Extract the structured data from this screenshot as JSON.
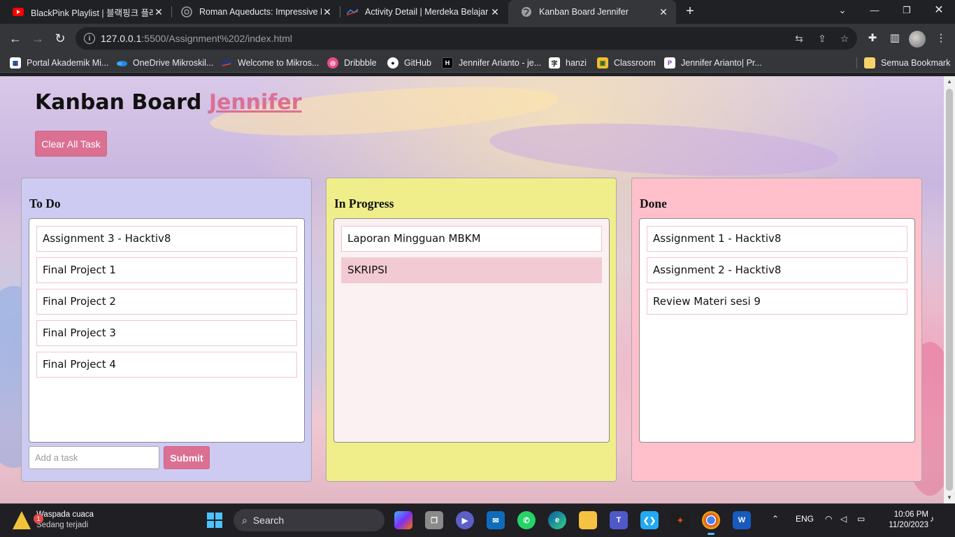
{
  "browser": {
    "tabs": [
      {
        "title": "BlackPink Playlist | 블랙핑크 플레이리스트",
        "icon": "youtube-icon"
      },
      {
        "title": "Roman Aqueducts: Impressive Engineering",
        "icon": "chatgpt-icon"
      },
      {
        "title": "Activity Detail | Merdeka Belajar",
        "icon": "merdeka-icon"
      },
      {
        "title": "Kanban Board Jennifer",
        "icon": "globe-icon"
      }
    ],
    "url_host": "127.0.0.1",
    "url_path": ":5500/Assignment%202/index.html",
    "bookmarks": [
      {
        "label": "Portal Akademik Mi...",
        "icon": "portal-icon"
      },
      {
        "label": "OneDrive Mikroskil...",
        "icon": "onedrive-icon"
      },
      {
        "label": "Welcome to Mikros...",
        "icon": "mikroskil-icon"
      },
      {
        "label": "Dribbble",
        "icon": "dribbble-icon"
      },
      {
        "label": "GitHub",
        "icon": "github-icon"
      },
      {
        "label": "Jennifer Arianto - je...",
        "icon": "hashnode-icon"
      },
      {
        "label": "hanzi",
        "icon": "hanzi-icon"
      },
      {
        "label": "Classroom",
        "icon": "classroom-icon"
      },
      {
        "label": "Jennifer Arianto| Pr...",
        "icon": "portfolio-icon"
      }
    ],
    "all_bookmarks": "Semua Bookmark"
  },
  "page": {
    "title_prefix": "Kanban Board ",
    "title_name": "Jennifer",
    "clear_button": "Clear All Task",
    "columns": {
      "todo": {
        "title": "To Do",
        "tasks": [
          "Assignment 3 - Hacktiv8",
          "Final Project 1",
          "Final Project 2",
          "Final Project 3",
          "Final Project 4"
        ]
      },
      "inprogress": {
        "title": "In Progress",
        "tasks": [
          "Laporan Mingguan MBKM",
          "SKRIPSI"
        ]
      },
      "done": {
        "title": "Done",
        "tasks": [
          "Assignment 1 - Hacktiv8",
          "Assignment 2 - Hacktiv8",
          "Review Materi sesi 9"
        ]
      }
    },
    "add_task_placeholder": "Add a task",
    "submit_label": "Submit",
    "colors": {
      "accent": "#db7093",
      "todo_bg": "#cdcbf2",
      "inprogress_bg": "#f0ee8a",
      "done_bg": "#ffc0cb"
    }
  },
  "taskbar": {
    "weather_title": "Waspada cuaca",
    "weather_sub": "Sedang terjadi",
    "weather_badge": "1",
    "search": "Search",
    "language": "ENG",
    "time": "10:06 PM",
    "date": "11/20/2023"
  }
}
